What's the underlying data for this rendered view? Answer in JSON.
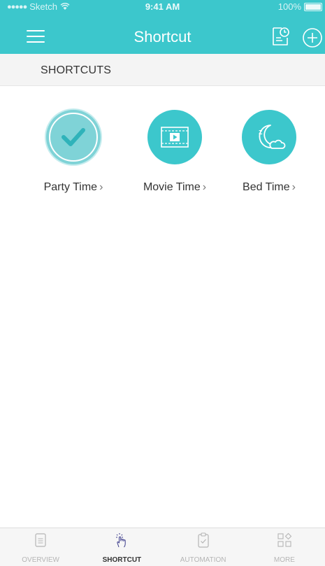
{
  "status_bar": {
    "carrier_dots": "●●●●●",
    "carrier": "Sketch",
    "time": "9:41 AM",
    "battery": "100%"
  },
  "nav": {
    "title": "Shortcut"
  },
  "section": {
    "title": "SHORTCUTS"
  },
  "shortcuts": [
    {
      "label": "Party Time",
      "icon": "checkmark-icon"
    },
    {
      "label": "Movie Time",
      "icon": "film-play-icon"
    },
    {
      "label": "Bed Time",
      "icon": "moon-cloud-sleep-icon"
    }
  ],
  "chevron": "›",
  "tabs": [
    {
      "label": "OVERVIEW",
      "icon": "list-doc-icon",
      "active": false
    },
    {
      "label": "SHORTCUT",
      "icon": "tap-hand-icon",
      "active": true
    },
    {
      "label": "AUTOMATION",
      "icon": "clipboard-check-icon",
      "active": false
    },
    {
      "label": "MORE",
      "icon": "grid-more-icon",
      "active": false
    }
  ],
  "colors": {
    "primary": "#3cc7cc",
    "primary_light": "#7fd3d7",
    "section_bg": "#f4f4f4",
    "text": "#333333",
    "tab_inactive": "#b5b5b5"
  }
}
